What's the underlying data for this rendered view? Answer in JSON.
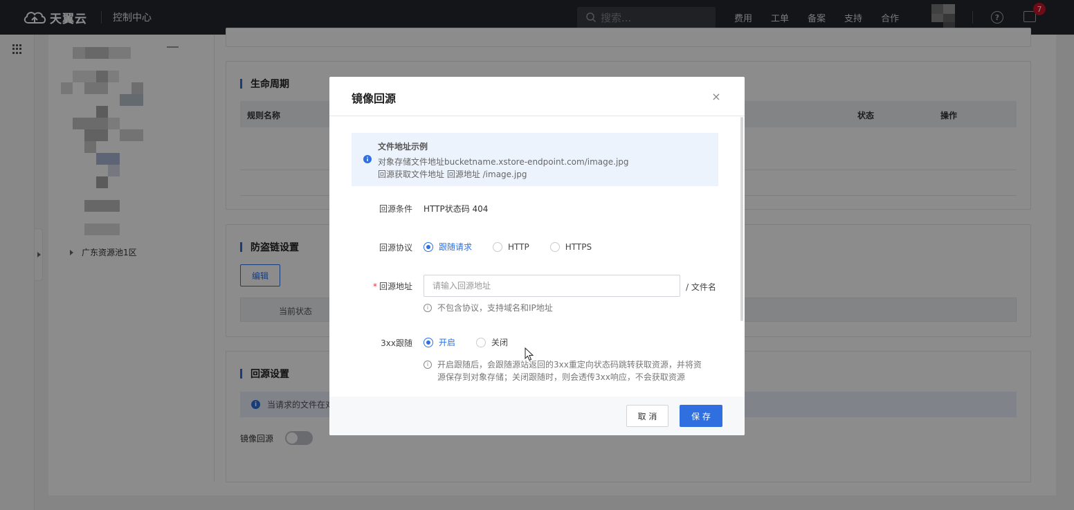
{
  "header": {
    "brand": "天翼云",
    "console_title": "控制中心",
    "search_placeholder": "搜索...",
    "nav": [
      "费用",
      "工单",
      "备案",
      "支持",
      "合作"
    ],
    "help_icon": "?",
    "message_count": "7"
  },
  "sidebar": {
    "tree_node": "广东资源池1区"
  },
  "lifecycle": {
    "title": "生命周期",
    "columns": [
      "规则名称",
      "状态",
      "操作"
    ]
  },
  "hotlink": {
    "title": "防盗链设置",
    "edit_label": "编辑",
    "state_header": "当前状态"
  },
  "origin": {
    "title": "回源设置",
    "info_text": "当请求的文件在对",
    "mirror_label": "镜像回源",
    "mirror_enabled": false
  },
  "modal": {
    "title": "镜像回源",
    "close_icon": "×",
    "example": {
      "title": "文件地址示例",
      "line1": "对象存储文件地址bucketname.xstore-endpoint.com/image.jpg",
      "line2": "回源获取文件地址 回源地址 /image.jpg"
    },
    "condition": {
      "label": "回源条件",
      "value": "HTTP状态码 404"
    },
    "protocol": {
      "label": "回源协议",
      "options": [
        "跟随请求",
        "HTTP",
        "HTTPS"
      ],
      "selected": "跟随请求"
    },
    "address": {
      "required_mark": "*",
      "label": "回源地址",
      "placeholder": "请输入回源地址",
      "value": "",
      "suffix": "/  文件名",
      "hint": "不包含协议，支持域名和IP地址"
    },
    "redirect": {
      "label": "3xx跟随",
      "options": [
        "开启",
        "关闭"
      ],
      "selected": "开启",
      "hint": "开启跟随后，会跟随源站返回的3xx重定向状态码跳转获取资源，并将资源保存到对象存储；关闭跟随时，则会透传3xx响应，不会获取资源"
    },
    "cancel_label": "取 消",
    "save_label": "保 存"
  },
  "colors": {
    "primary": "#2f6fe0",
    "topbar": "#24272e",
    "badge": "#c7142b",
    "info_bg": "#edf3fd"
  }
}
